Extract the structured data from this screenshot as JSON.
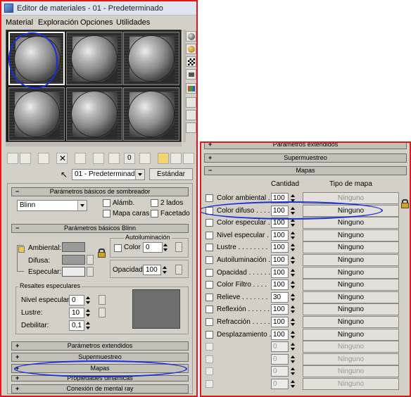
{
  "window": {
    "title": "Editor de materiales - 01 - Predeterminado"
  },
  "menu": [
    "Material",
    "Exploración",
    "Opciones",
    "Utilidades"
  ],
  "material": {
    "name": "01 - Predeterminado",
    "type_button": "Estándar"
  },
  "shader_rollout": {
    "title": "Parámetros básicos de sombreador",
    "shader": "Blinn",
    "options": [
      "Alámb.",
      "2 lados",
      "Mapa caras",
      "Facetado"
    ]
  },
  "blinn_rollout": {
    "title": "Parámetros básicos Blinn",
    "self_illum_group": "Autoiluminación",
    "color_label": "Color",
    "color_value": "0",
    "ambient_label": "Ambiental:",
    "diffuse_label": "Difusa:",
    "specular_label": "Especular:",
    "opacity_label": "Opacidad:",
    "opacity_value": "100",
    "colors": {
      "ambient": "#9a9a9a",
      "diffuse": "#9a9a9a",
      "specular": "#ececec"
    }
  },
  "specular_highlights": {
    "title": "Resaltes especulares",
    "level_label": "Nivel especular:",
    "level_value": "0",
    "gloss_label": "Lustre:",
    "gloss_value": "10",
    "soften_label": "Debilitar:",
    "soften_value": "0,1"
  },
  "left_rollouts": [
    "Parámetros extendidos",
    "Supermuestreo",
    "Mapas",
    "Propiedades dinámicas",
    "Conexión de mental ray"
  ],
  "right_rollouts": {
    "extended": "Parámetros extendidos",
    "supersampling": "Supermuestreo",
    "maps": "Mapas"
  },
  "maps": {
    "col_amount": "Cantidad",
    "col_type": "Tipo de mapa",
    "rows": [
      {
        "label": "Color ambiental .",
        "amount": "100",
        "map": "Ninguno",
        "state": "grey"
      },
      {
        "label": "Color difuso . . . .",
        "amount": "100",
        "map": "Ninguno",
        "state": "normal"
      },
      {
        "label": "Color especular .",
        "amount": "100",
        "map": "Ninguno",
        "state": "normal"
      },
      {
        "label": "Nivel especular .",
        "amount": "100",
        "map": "Ninguno",
        "state": "normal"
      },
      {
        "label": "Lustre . . . . . . . .",
        "amount": "100",
        "map": "Ninguno",
        "state": "normal"
      },
      {
        "label": "Autoiluminación .",
        "amount": "100",
        "map": "Ninguno",
        "state": "normal"
      },
      {
        "label": "Opacidad . . . . . .",
        "amount": "100",
        "map": "Ninguno",
        "state": "normal"
      },
      {
        "label": "Color Filtro . . . .",
        "amount": "100",
        "map": "Ninguno",
        "state": "normal"
      },
      {
        "label": "Relieve . . . . . . .",
        "amount": "30",
        "map": "Ninguno",
        "state": "normal"
      },
      {
        "label": "Reflexión . . . . . .",
        "amount": "100",
        "map": "Ninguno",
        "state": "normal"
      },
      {
        "label": "Refracción . . . . .",
        "amount": "100",
        "map": "Ninguno",
        "state": "normal"
      },
      {
        "label": "Desplazamiento .",
        "amount": "100",
        "map": "Ninguno",
        "state": "normal"
      },
      {
        "label": "",
        "amount": "0",
        "map": "Ninguno",
        "state": "dis"
      },
      {
        "label": "",
        "amount": "0",
        "map": "Ninguno",
        "state": "dis"
      },
      {
        "label": "",
        "amount": "0",
        "map": "Ninguno",
        "state": "dis"
      },
      {
        "label": "",
        "amount": "0",
        "map": "Ninguno",
        "state": "dis"
      }
    ]
  },
  "colors": {
    "frame_border": "#e01818",
    "annotation": "#1a2ed6",
    "panel_bg": "#d4d0c8"
  }
}
